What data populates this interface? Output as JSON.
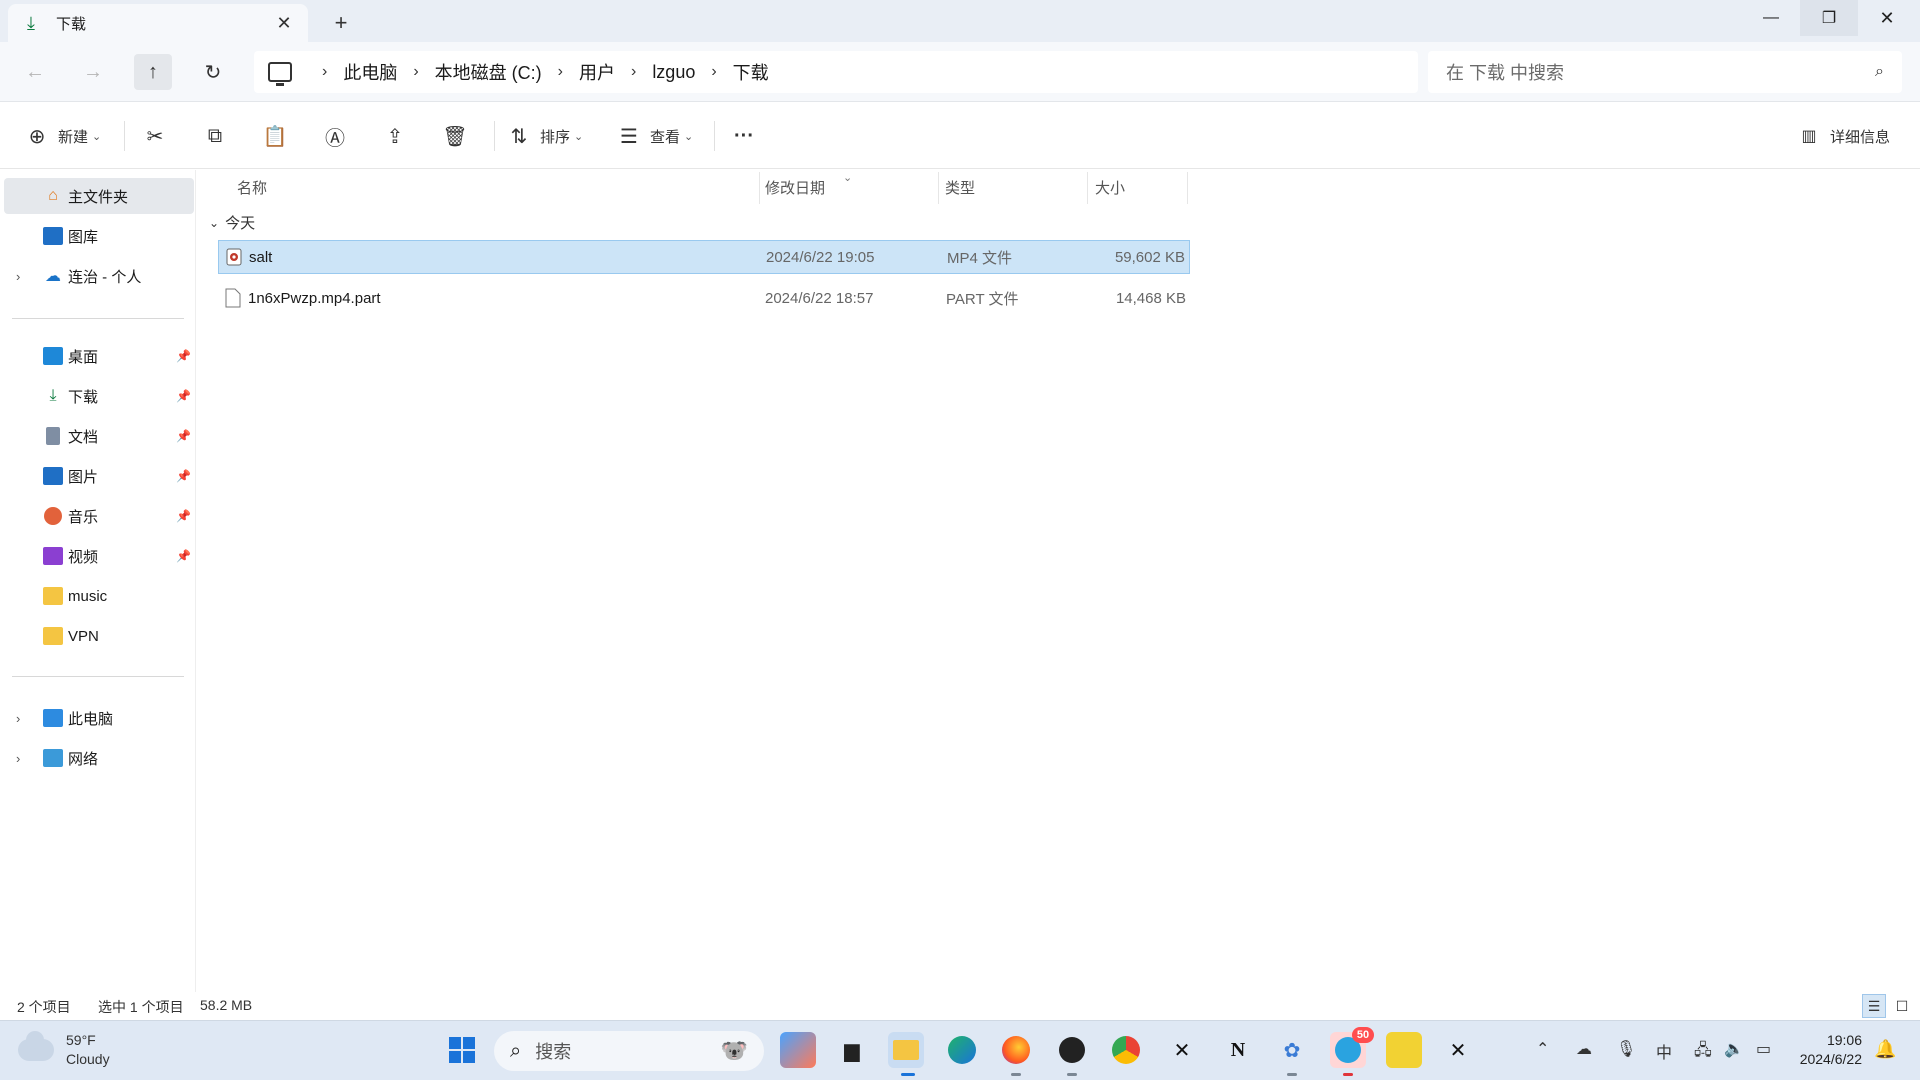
{
  "window": {
    "tab_title": "下载",
    "tab_icon": "download-icon",
    "new_tab_symbol": "+",
    "min_symbol": "—",
    "max_symbol": "❐",
    "close_symbol": "✕"
  },
  "nav": {
    "back": "←",
    "forward": "→",
    "up": "↑",
    "refresh": "↻"
  },
  "breadcrumb": {
    "items": [
      "此电脑",
      "本地磁盘 (C:)",
      "用户",
      "lzguo",
      "下载"
    ],
    "separator": "›"
  },
  "search": {
    "placeholder": "在 下载 中搜索"
  },
  "toolbar": {
    "new_label": "新建",
    "sort_label": "排序",
    "view_label": "查看",
    "more_label": "···",
    "details_label": "详细信息"
  },
  "sidebar": {
    "top": [
      {
        "label": "主文件夹",
        "icon": "home-icon",
        "selected": true
      },
      {
        "label": "图库",
        "icon": "gallery-icon"
      },
      {
        "label": "连治 - 个人",
        "icon": "onedrive-icon",
        "expandable": true
      }
    ],
    "quick": [
      {
        "label": "桌面",
        "icon": "desktop-icon",
        "pinned": true
      },
      {
        "label": "下载",
        "icon": "download-icon",
        "pinned": true
      },
      {
        "label": "文档",
        "icon": "documents-icon",
        "pinned": true
      },
      {
        "label": "图片",
        "icon": "pictures-icon",
        "pinned": true
      },
      {
        "label": "音乐",
        "icon": "music-icon",
        "pinned": true
      },
      {
        "label": "视频",
        "icon": "videos-icon",
        "pinned": true
      },
      {
        "label": "music",
        "icon": "folder-icon"
      },
      {
        "label": "VPN",
        "icon": "folder-icon"
      }
    ],
    "bottom": [
      {
        "label": "此电脑",
        "icon": "this-pc-icon",
        "expandable": true
      },
      {
        "label": "网络",
        "icon": "network-icon",
        "expandable": true
      }
    ]
  },
  "columns": {
    "name": "名称",
    "date": "修改日期",
    "type": "类型",
    "size": "大小"
  },
  "group_label": "今天",
  "files": [
    {
      "name": "salt",
      "date": "2024/6/22 19:05",
      "type": "MP4 文件",
      "size": "59,602 KB",
      "icon": "video-file-icon",
      "selected": true
    },
    {
      "name": "1n6xPwzp.mp4.part",
      "date": "2024/6/22 18:57",
      "type": "PART 文件",
      "size": "14,468 KB",
      "icon": "blank-file-icon",
      "selected": false
    }
  ],
  "status": {
    "count": "2 个项目",
    "selection": "选中 1 个项目",
    "size": "58.2 MB"
  },
  "taskbar": {
    "weather_temp": "59°F",
    "weather_desc": "Cloudy",
    "search_label": "搜索",
    "ime": "中",
    "time": "19:06",
    "date": "2024/6/22",
    "badge": "50"
  }
}
